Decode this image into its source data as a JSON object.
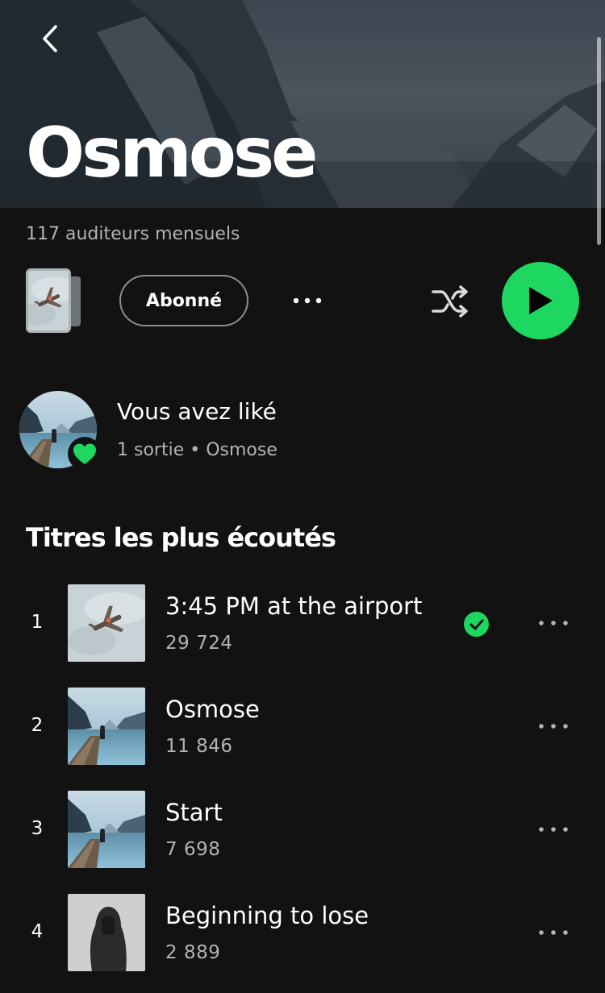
{
  "header": {
    "artist_name": "Osmose",
    "monthly_listeners": "117 auditeurs mensuels"
  },
  "actions": {
    "follow_label": "Abonné",
    "play_color": "#1ed760"
  },
  "liked": {
    "title": "Vous avez liké",
    "subtitle": "1 sortie • Osmose"
  },
  "section": {
    "title": "Titres les plus écoutés"
  },
  "tracks": [
    {
      "rank": "1",
      "title": "3:45 PM at the airport",
      "plays": "29 724",
      "cover": "plane",
      "downloaded": true
    },
    {
      "rank": "2",
      "title": "Osmose",
      "plays": "11 846",
      "cover": "fjord",
      "downloaded": false
    },
    {
      "rank": "3",
      "title": "Start",
      "plays": "7 698",
      "cover": "fjord",
      "downloaded": false
    },
    {
      "rank": "4",
      "title": "Beginning to lose",
      "plays": "2 889",
      "cover": "hooded-figure",
      "downloaded": false
    }
  ],
  "icons": {
    "back": "chevron-left-icon",
    "more": "more-horizontal-icon",
    "shuffle": "shuffle-icon",
    "play": "play-icon",
    "heart": "heart-icon",
    "check": "check-circle-icon"
  },
  "colors": {
    "background": "#121212",
    "accent": "#1ed760",
    "secondary_text": "#b3b3b3"
  }
}
